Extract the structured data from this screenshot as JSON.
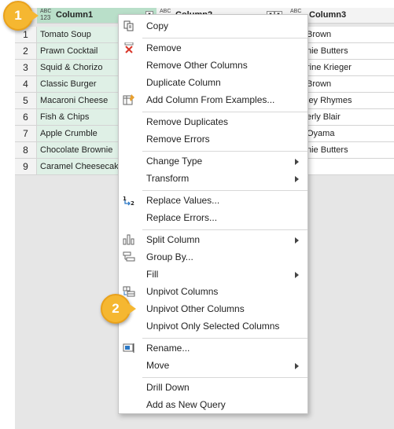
{
  "columns": [
    {
      "type_top": "ABC",
      "type_bottom": "123",
      "name": "Column1"
    },
    {
      "type_top": "ABC",
      "type_bottom": "",
      "name": "Column2"
    },
    {
      "type_top": "ABC",
      "type_bottom": "",
      "name": "Column3"
    }
  ],
  "rows": [
    {
      "num": "1",
      "col1": "Tomato Soup",
      "col3": "Brown"
    },
    {
      "num": "2",
      "col1": "Prawn Cocktail",
      "col3": "nie Butters"
    },
    {
      "num": "3",
      "col1": "Squid & Chorizo",
      "col3": "rine Krieger"
    },
    {
      "num": "4",
      "col1": "Classic Burger",
      "col3": "Brown"
    },
    {
      "num": "5",
      "col1": "Macaroni Cheese",
      "col3": "ley Rhymes"
    },
    {
      "num": "6",
      "col1": "Fish & Chips",
      "col3": "erly Blair"
    },
    {
      "num": "7",
      "col1": "Apple Crumble",
      "col3": "Oyama"
    },
    {
      "num": "8",
      "col1": "Chocolate Brownie",
      "col3": "nie Butters"
    },
    {
      "num": "9",
      "col1": "Caramel Cheesecake",
      "col3": ""
    }
  ],
  "menu": {
    "copy": "Copy",
    "remove": "Remove",
    "remove_other_columns": "Remove Other Columns",
    "duplicate_column": "Duplicate Column",
    "add_column_from_examples": "Add Column From Examples...",
    "remove_duplicates": "Remove Duplicates",
    "remove_errors": "Remove Errors",
    "change_type": "Change Type",
    "transform": "Transform",
    "replace_values": "Replace Values...",
    "replace_errors": "Replace Errors...",
    "split_column": "Split Column",
    "group_by": "Group By...",
    "fill": "Fill",
    "unpivot_columns": "Unpivot Columns",
    "unpivot_other_columns": "Unpivot Other Columns",
    "unpivot_only_selected": "Unpivot Only Selected Columns",
    "rename": "Rename...",
    "move": "Move",
    "drill_down": "Drill Down",
    "add_as_new_query": "Add as New Query"
  },
  "icons": {
    "replace_values_glyph": "1↳2",
    "accent_color": "#f5b731",
    "selected_column_color": "#b9dfc9"
  },
  "badges": {
    "step1": "1",
    "step2": "2"
  }
}
